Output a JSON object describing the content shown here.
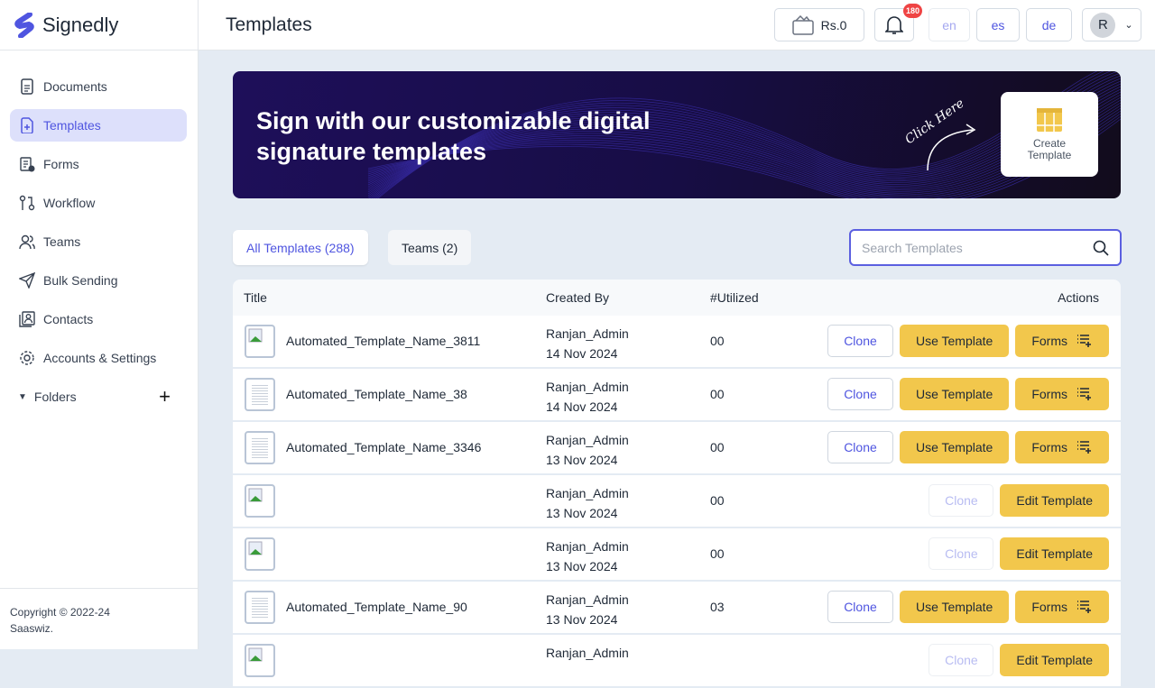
{
  "app": {
    "name": "Signedly",
    "copyright": "Copyright © 2022-24",
    "company": "Saaswiz."
  },
  "sidebar": {
    "items": [
      {
        "label": "Documents",
        "icon": "document-icon"
      },
      {
        "label": "Templates",
        "icon": "template-icon",
        "active": true
      },
      {
        "label": "Forms",
        "icon": "forms-icon"
      },
      {
        "label": "Workflow",
        "icon": "workflow-icon"
      },
      {
        "label": "Teams",
        "icon": "teams-icon"
      },
      {
        "label": "Bulk Sending",
        "icon": "send-icon"
      },
      {
        "label": "Contacts",
        "icon": "contacts-icon"
      },
      {
        "label": "Accounts & Settings",
        "icon": "gear-icon"
      }
    ],
    "folders": "Folders"
  },
  "header": {
    "title": "Templates",
    "wallet": "Rs.0",
    "notifications": "180",
    "langs": [
      "en",
      "es",
      "de"
    ],
    "avatar": "R"
  },
  "banner": {
    "headline": "Sign with our customizable digital signature templates",
    "hint": "Click Here",
    "create": "Create Template"
  },
  "tabs": [
    {
      "label": "All Templates (288)",
      "active": true
    },
    {
      "label": "Teams (2)"
    }
  ],
  "search": {
    "placeholder": "Search Templates"
  },
  "table": {
    "headers": [
      "Title",
      "Created By",
      "#Utilized",
      "Actions"
    ],
    "rows": [
      {
        "title": "Automated_Template_Name_3811",
        "by": "Ranjan_Admin",
        "date": "14 Nov 2024",
        "utilized": "00",
        "type": "use"
      },
      {
        "title": "Automated_Template_Name_38",
        "by": "Ranjan_Admin",
        "date": "14 Nov 2024",
        "utilized": "00",
        "type": "use"
      },
      {
        "title": "Automated_Template_Name_3346",
        "by": "Ranjan_Admin",
        "date": "13 Nov 2024",
        "utilized": "00",
        "type": "use"
      },
      {
        "title": "",
        "by": "Ranjan_Admin",
        "date": "13 Nov 2024",
        "utilized": "00",
        "type": "edit"
      },
      {
        "title": "",
        "by": "Ranjan_Admin",
        "date": "13 Nov 2024",
        "utilized": "00",
        "type": "edit"
      },
      {
        "title": "Automated_Template_Name_90",
        "by": "Ranjan_Admin",
        "date": "13 Nov 2024",
        "utilized": "03",
        "type": "use"
      },
      {
        "title": "",
        "by": "Ranjan_Admin",
        "date": "",
        "utilized": "",
        "type": "edit"
      }
    ],
    "labels": {
      "clone": "Clone",
      "use": "Use Template",
      "forms": "Forms",
      "edit": "Edit Template"
    }
  },
  "colors": {
    "accent": "#4f55e0",
    "yellow": "#f2c74c",
    "banner": "#1e0f5a"
  }
}
